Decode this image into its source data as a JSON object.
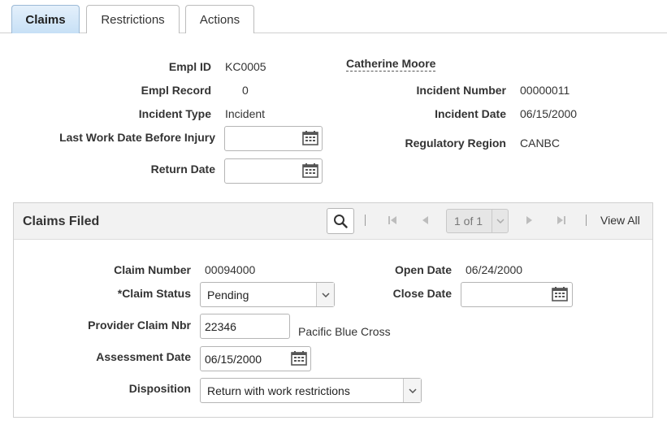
{
  "tabs": [
    {
      "label": "Claims"
    },
    {
      "label": "Restrictions"
    },
    {
      "label": "Actions"
    }
  ],
  "header": {
    "empl_id_label": "Empl ID",
    "empl_id_value": "KC0005",
    "employee_name": "Catherine Moore",
    "empl_record_label": "Empl Record",
    "empl_record_value": "0",
    "incident_number_label": "Incident Number",
    "incident_number_value": "00000011",
    "incident_type_label": "Incident Type",
    "incident_type_value": "Incident",
    "incident_date_label": "Incident Date",
    "incident_date_value": "06/15/2000",
    "last_work_date_label": "Last Work Date Before Injury",
    "last_work_date_value": "",
    "regulatory_region_label": "Regulatory Region",
    "regulatory_region_value": "CANBC",
    "return_date_label": "Return Date",
    "return_date_value": ""
  },
  "claims_filed": {
    "title": "Claims Filed",
    "pager_text": "1 of 1",
    "view_all": "View All",
    "claim_number_label": "Claim Number",
    "claim_number_value": "00094000",
    "open_date_label": "Open Date",
    "open_date_value": "06/24/2000",
    "claim_status_label": "*Claim Status",
    "claim_status_value": "Pending",
    "close_date_label": "Close Date",
    "close_date_value": "",
    "provider_claim_label": "Provider Claim Nbr",
    "provider_claim_value": "22346",
    "provider_name": "Pacific Blue Cross",
    "assessment_date_label": "Assessment Date",
    "assessment_date_value": "06/15/2000",
    "disposition_label": "Disposition",
    "disposition_value": "Return with work restrictions"
  }
}
